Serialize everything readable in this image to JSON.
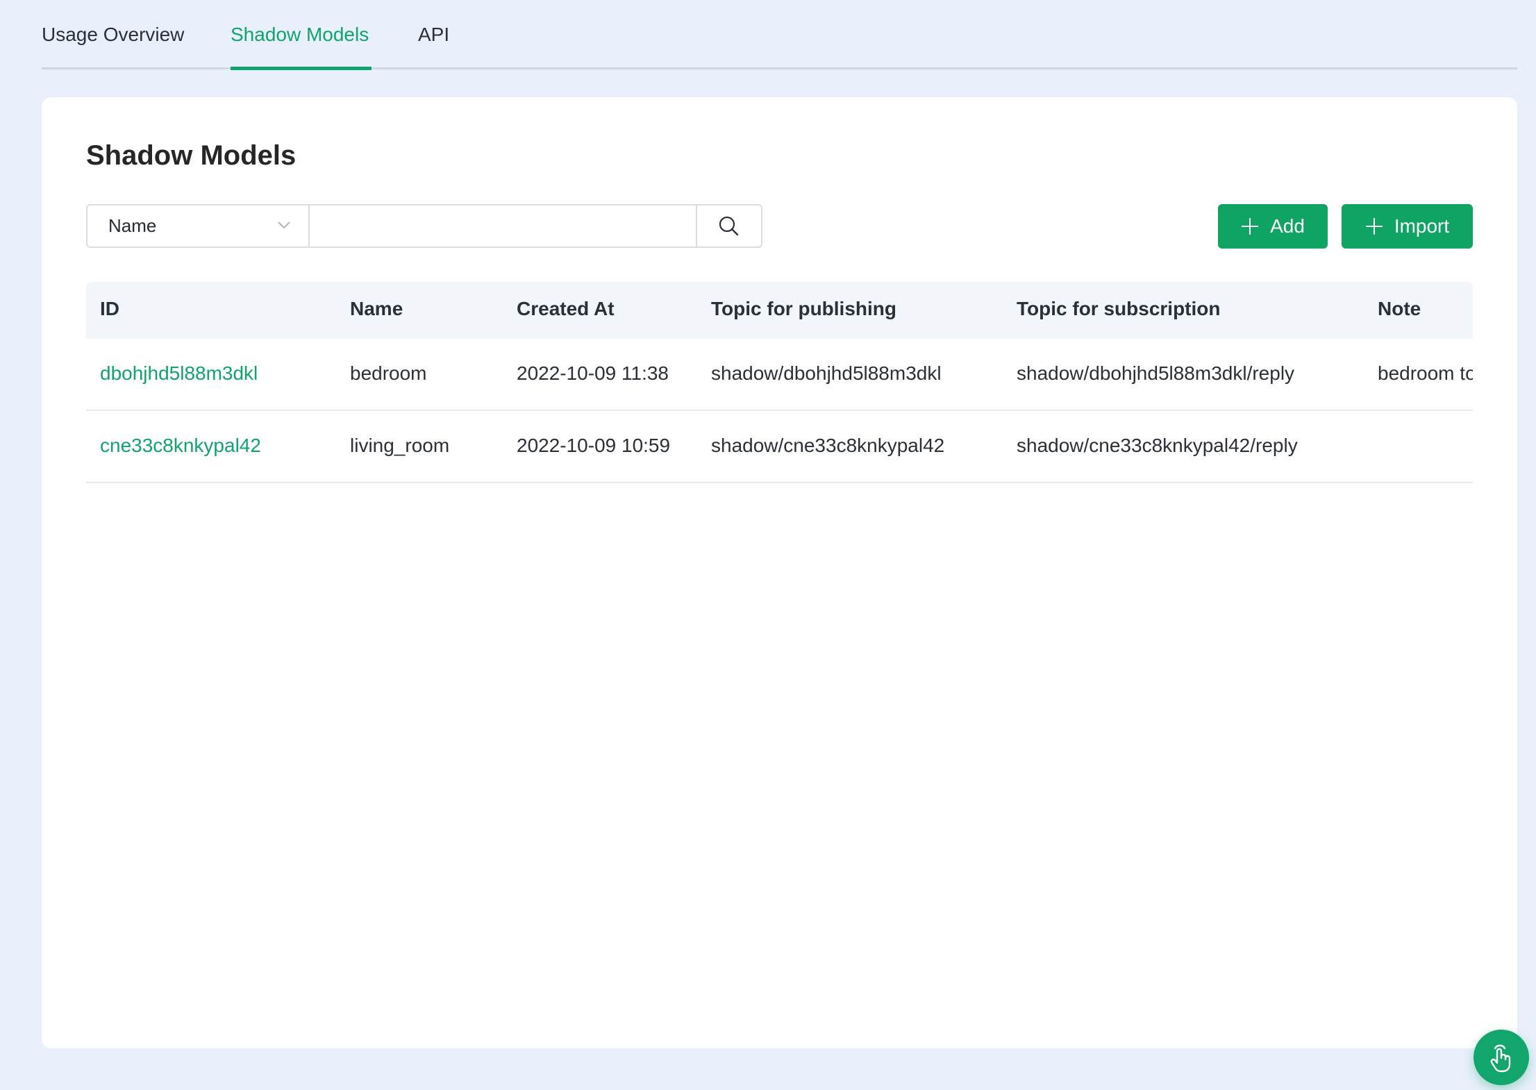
{
  "tabs": [
    {
      "label": "Usage Overview",
      "active": false
    },
    {
      "label": "Shadow Models",
      "active": true
    },
    {
      "label": "API",
      "active": false
    }
  ],
  "page": {
    "title": "Shadow Models"
  },
  "search": {
    "field_select_value": "Name",
    "input_value": "",
    "input_placeholder": ""
  },
  "actions": {
    "add_label": "Add",
    "import_label": "Import"
  },
  "table": {
    "columns": [
      "ID",
      "Name",
      "Created At",
      "Topic for publishing",
      "Topic for subscription",
      "Note"
    ],
    "rows": [
      {
        "id": "dbohjhd5l88m3dkl",
        "name": "bedroom",
        "created_at": "2022-10-09 11:38",
        "topic_publishing": "shadow/dbohjhd5l88m3dkl",
        "topic_subscription": "shadow/dbohjhd5l88m3dkl/reply",
        "note": "bedroom to"
      },
      {
        "id": "cne33c8knkypal42",
        "name": "living_room",
        "created_at": "2022-10-09 10:59",
        "topic_publishing": "shadow/cne33c8knkypal42",
        "topic_subscription": "shadow/cne33c8knkypal42/reply",
        "note": ""
      }
    ]
  },
  "colors": {
    "accent": "#10a46c",
    "button": "#10a464",
    "background": "#e9f0fb",
    "table_header_bg": "#f2f5f9"
  },
  "icons": {
    "select_chevron": "chevron-down-icon",
    "search": "search-icon",
    "add": "plus-icon",
    "import": "plus-icon",
    "fab": "pointer-hand-icon"
  }
}
